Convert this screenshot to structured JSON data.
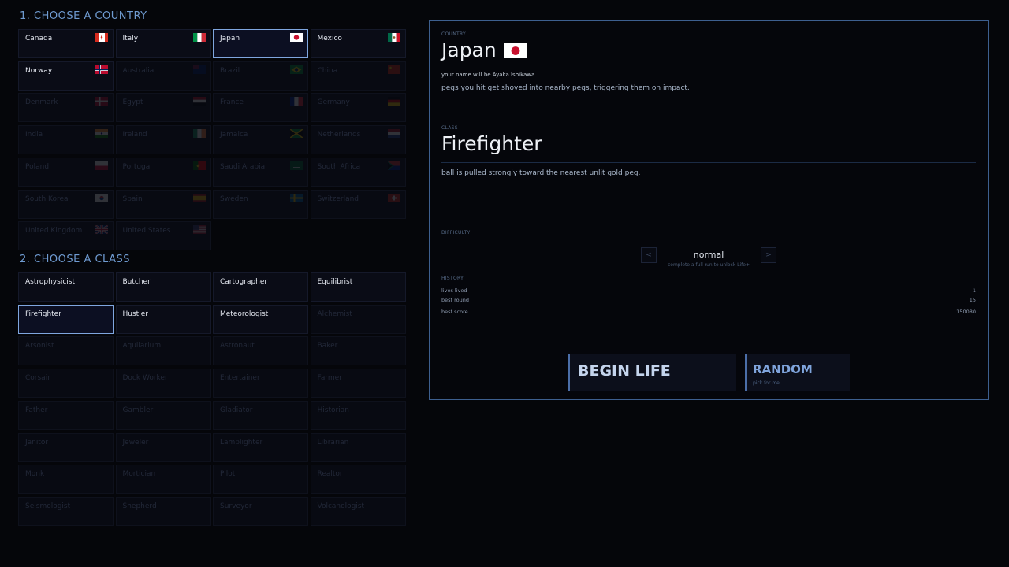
{
  "section_country": "1.  CHOOSE A COUNTRY",
  "section_class": "2.  CHOOSE A CLASS",
  "countries": [
    {
      "label": "Canada",
      "flag": "canada",
      "locked": false,
      "selected": false
    },
    {
      "label": "Italy",
      "flag": "italy",
      "locked": false,
      "selected": false
    },
    {
      "label": "Japan",
      "flag": "japan",
      "locked": false,
      "selected": true
    },
    {
      "label": "Mexico",
      "flag": "mexico",
      "locked": false,
      "selected": false
    },
    {
      "label": "Norway",
      "flag": "norway",
      "locked": false,
      "selected": false
    },
    {
      "label": "Australia",
      "flag": "australia",
      "locked": true,
      "selected": false
    },
    {
      "label": "Brazil",
      "flag": "brazil",
      "locked": true,
      "selected": false
    },
    {
      "label": "China",
      "flag": "china",
      "locked": true,
      "selected": false
    },
    {
      "label": "Denmark",
      "flag": "denmark",
      "locked": true,
      "selected": false
    },
    {
      "label": "Egypt",
      "flag": "egypt",
      "locked": true,
      "selected": false
    },
    {
      "label": "France",
      "flag": "france",
      "locked": true,
      "selected": false
    },
    {
      "label": "Germany",
      "flag": "germany",
      "locked": true,
      "selected": false
    },
    {
      "label": "India",
      "flag": "india",
      "locked": true,
      "selected": false
    },
    {
      "label": "Ireland",
      "flag": "ireland",
      "locked": true,
      "selected": false
    },
    {
      "label": "Jamaica",
      "flag": "jamaica",
      "locked": true,
      "selected": false
    },
    {
      "label": "Netherlands",
      "flag": "netherlands",
      "locked": true,
      "selected": false
    },
    {
      "label": "Poland",
      "flag": "poland",
      "locked": true,
      "selected": false
    },
    {
      "label": "Portugal",
      "flag": "portugal",
      "locked": true,
      "selected": false
    },
    {
      "label": "Saudi Arabia",
      "flag": "saudi-arabia",
      "locked": true,
      "selected": false
    },
    {
      "label": "South Africa",
      "flag": "south-africa",
      "locked": true,
      "selected": false
    },
    {
      "label": "South Korea",
      "flag": "south-korea",
      "locked": true,
      "selected": false
    },
    {
      "label": "Spain",
      "flag": "spain",
      "locked": true,
      "selected": false
    },
    {
      "label": "Sweden",
      "flag": "sweden",
      "locked": true,
      "selected": false
    },
    {
      "label": "Switzerland",
      "flag": "switzerland",
      "locked": true,
      "selected": false
    },
    {
      "label": "United Kingdom",
      "flag": "united-kingdom",
      "locked": true,
      "selected": false
    },
    {
      "label": "United States",
      "flag": "united-states",
      "locked": true,
      "selected": false
    }
  ],
  "classes": [
    {
      "label": "Astrophysicist",
      "locked": false,
      "selected": false
    },
    {
      "label": "Butcher",
      "locked": false,
      "selected": false
    },
    {
      "label": "Cartographer",
      "locked": false,
      "selected": false
    },
    {
      "label": "Equilibrist",
      "locked": false,
      "selected": false
    },
    {
      "label": "Firefighter",
      "locked": false,
      "selected": true
    },
    {
      "label": "Hustler",
      "locked": false,
      "selected": false
    },
    {
      "label": "Meteorologist",
      "locked": false,
      "selected": false
    },
    {
      "label": "Alchemist",
      "locked": true,
      "selected": false
    },
    {
      "label": "Arsonist",
      "locked": true,
      "selected": false
    },
    {
      "label": "Aquilarium",
      "locked": true,
      "selected": false
    },
    {
      "label": "Astronaut",
      "locked": true,
      "selected": false
    },
    {
      "label": "Baker",
      "locked": true,
      "selected": false
    },
    {
      "label": "Corsair",
      "locked": true,
      "selected": false
    },
    {
      "label": "Dock Worker",
      "locked": true,
      "selected": false
    },
    {
      "label": "Entertainer",
      "locked": true,
      "selected": false
    },
    {
      "label": "Farmer",
      "locked": true,
      "selected": false
    },
    {
      "label": "Father",
      "locked": true,
      "selected": false
    },
    {
      "label": "Gambler",
      "locked": true,
      "selected": false
    },
    {
      "label": "Gladiator",
      "locked": true,
      "selected": false
    },
    {
      "label": "Historian",
      "locked": true,
      "selected": false
    },
    {
      "label": "Janitor",
      "locked": true,
      "selected": false
    },
    {
      "label": "Jeweler",
      "locked": true,
      "selected": false
    },
    {
      "label": "Lamplighter",
      "locked": true,
      "selected": false
    },
    {
      "label": "Librarian",
      "locked": true,
      "selected": false
    },
    {
      "label": "Monk",
      "locked": true,
      "selected": false
    },
    {
      "label": "Mortician",
      "locked": true,
      "selected": false
    },
    {
      "label": "Pilot",
      "locked": true,
      "selected": false
    },
    {
      "label": "Realtor",
      "locked": true,
      "selected": false
    },
    {
      "label": "Seismologist",
      "locked": true,
      "selected": false
    },
    {
      "label": "Shepherd",
      "locked": true,
      "selected": false
    },
    {
      "label": "Surveyor",
      "locked": true,
      "selected": false
    },
    {
      "label": "Volcanologist",
      "locked": true,
      "selected": false
    }
  ],
  "detail": {
    "country_caption": "COUNTRY",
    "country_name": "Japan",
    "country_flag": "japan",
    "name_line": "your name will be Ayaka Ishikawa",
    "country_desc": "pegs you hit get shoved into nearby pegs, triggering them on impact.",
    "class_caption": "CLASS",
    "class_name": "Firefighter",
    "class_desc": "ball is pulled strongly toward the nearest unlit gold peg.",
    "difficulty_caption": "DIFFICULTY",
    "difficulty_prev": "<",
    "difficulty_next": ">",
    "difficulty_value": "normal",
    "difficulty_hint": "complete a full run to unlock Life+",
    "history_caption": "HISTORY",
    "history": [
      {
        "key": "lives lived",
        "value": "1"
      },
      {
        "key": "best round",
        "value": "15"
      },
      {
        "key": "best score",
        "value": "150080"
      }
    ],
    "begin_label": "BEGIN LIFE",
    "random_label": "RANDOM",
    "random_sub": "pick for me"
  }
}
